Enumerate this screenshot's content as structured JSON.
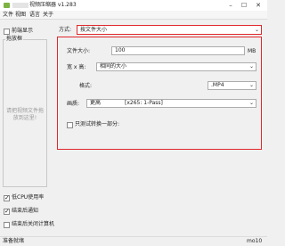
{
  "window": {
    "title": "视频压缩器 v1.283",
    "minimize": "–",
    "maximize": "☐",
    "close": "✕"
  },
  "menu": [
    "文件",
    "视图",
    "语言",
    "关于"
  ],
  "left": {
    "preview_label": "前端显示",
    "drop_box_title": "拖放框",
    "drop_hint_line1": "请把视频文件拖",
    "drop_hint_line2": "放到这里!",
    "low_cpu_label": "低CPU使用率",
    "notify_label": "结束后通知",
    "shutdown_label": "结束后关闭计算机"
  },
  "right": {
    "mode_label": "方式:",
    "mode_value": "按文件大小",
    "filesize_label": "文件大小:",
    "filesize_value": "100",
    "filesize_unit": "MB",
    "resolution_label": "宽 x 高:",
    "resolution_value": "相同的大小",
    "format_label": "格式:",
    "format_value": ".MP4",
    "quality_label": "画质:",
    "quality_value": "更高",
    "quality_codec": "[x265: 1-Pass]",
    "partial_label": "只测试转换一部分:"
  },
  "status": {
    "left": "准备就绪",
    "right": "mo10"
  },
  "colors": {
    "highlight": "#e0282c",
    "background": "#f0f0f0"
  }
}
